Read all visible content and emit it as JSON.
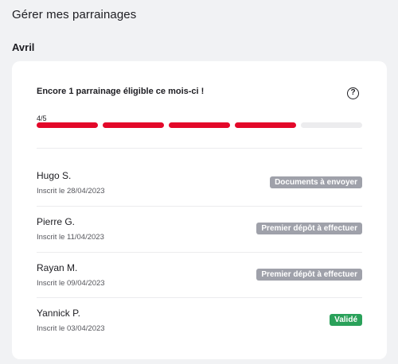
{
  "header": {
    "title": "Gérer mes parrainages"
  },
  "section": {
    "month": "Avril"
  },
  "summary": {
    "headline": "Encore 1 parrainage éligible ce mois-ci !",
    "help_icon": "question-circle-icon",
    "progress_label": "4/5",
    "progress_done": 4,
    "progress_total": 5,
    "colors": {
      "filled": "#e3082a",
      "empty": "#ececee"
    }
  },
  "referrals": [
    {
      "name": "Hugo S.",
      "date": "Inscrit le 28/04/2023",
      "status": "Documents à envoyer",
      "status_color": "#9fa1aa"
    },
    {
      "name": "Pierre G.",
      "date": "Inscrit le 11/04/2023",
      "status": "Premier dépôt à effectuer",
      "status_color": "#9fa1aa"
    },
    {
      "name": "Rayan M.",
      "date": "Inscrit le 09/04/2023",
      "status": "Premier dépôt à effectuer",
      "status_color": "#9fa1aa"
    },
    {
      "name": "Yannick P.",
      "date": "Inscrit le 03/04/2023",
      "status": "Validé",
      "status_color": "#2aa15a"
    }
  ]
}
